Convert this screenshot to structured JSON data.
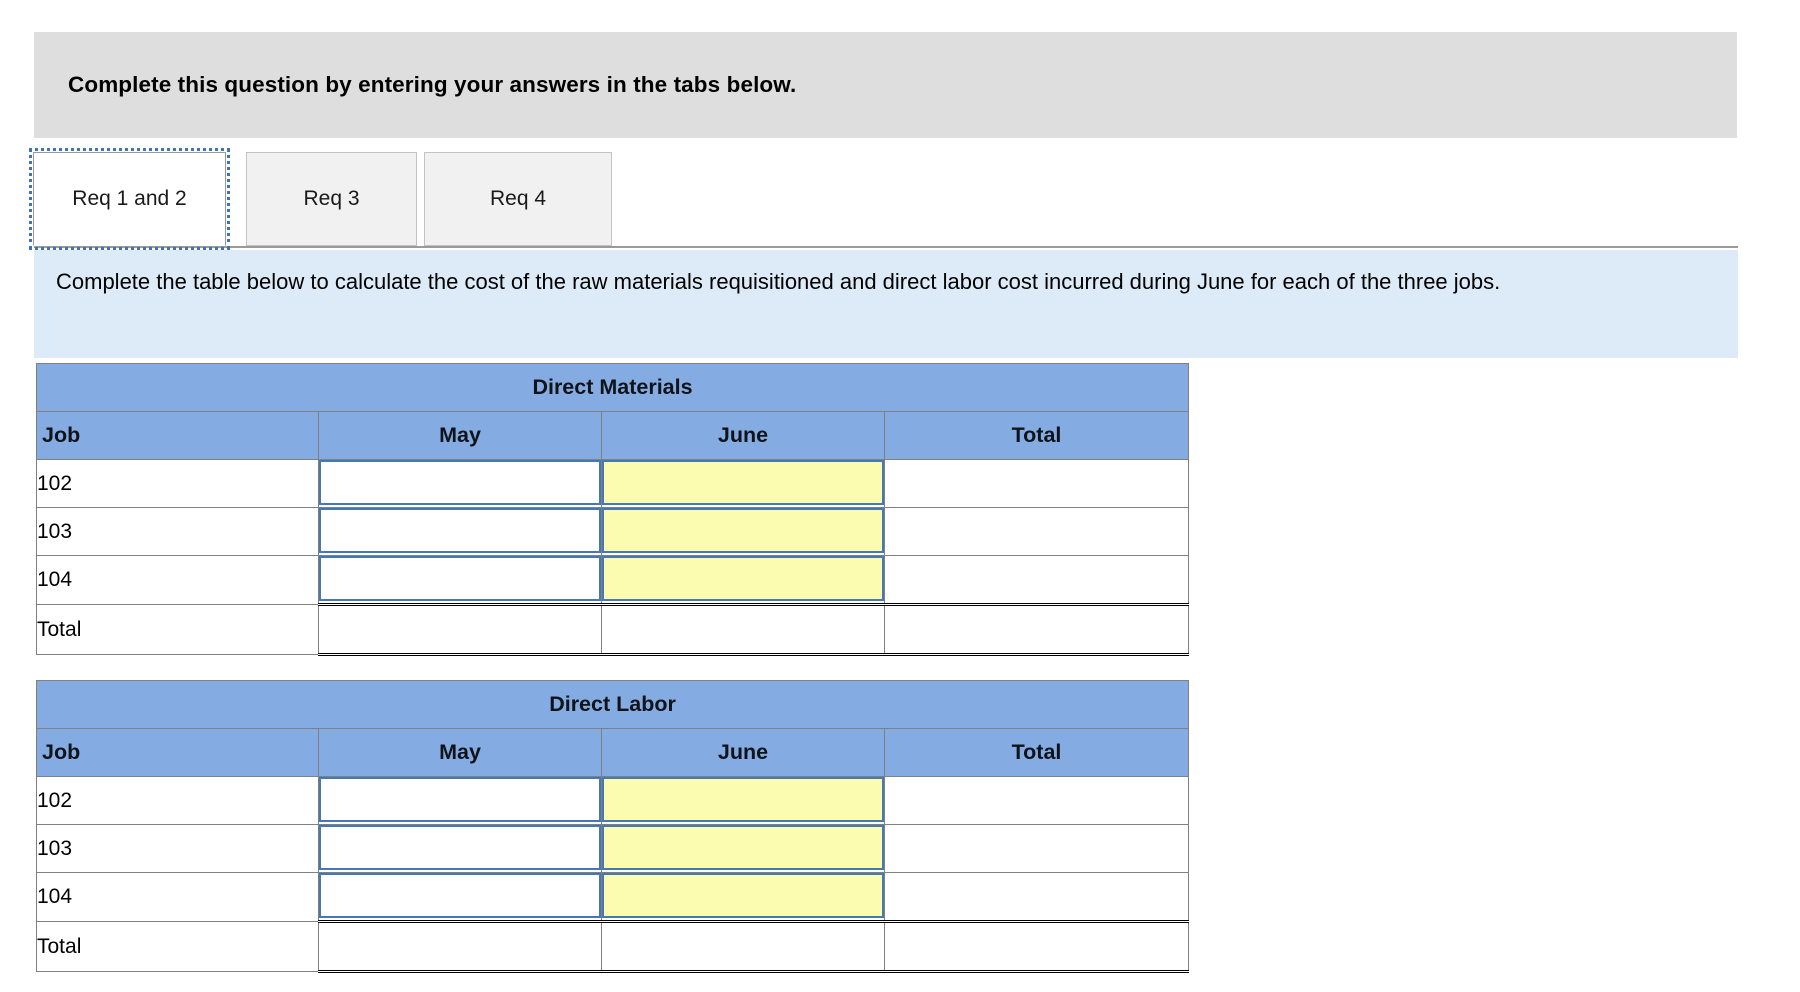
{
  "banner": {
    "title": "Complete this question by entering your answers in the tabs below."
  },
  "tabs": {
    "items": [
      {
        "label": "Req 1 and 2",
        "selected": true
      },
      {
        "label": "Req 3",
        "selected": false
      },
      {
        "label": "Req 4",
        "selected": false
      }
    ]
  },
  "instruction": {
    "text": "Complete the table below to calculate the cost of the raw materials requisitioned and direct labor cost incurred during June for each of the three jobs."
  },
  "colors": {
    "header_blue": "#84ace2",
    "input_yellow": "#fcfcb0",
    "input_border_blue": "#4678b4",
    "instruction_panel": "#dcebf7",
    "banner_gray": "#dedede",
    "grid_line": "#808080"
  },
  "tables": [
    {
      "title": "Direct Materials",
      "columns": [
        "Job",
        "May",
        "June",
        "Total"
      ],
      "rows": [
        {
          "job": "102",
          "may": "",
          "june": "",
          "total": ""
        },
        {
          "job": "103",
          "may": "",
          "june": "",
          "total": ""
        },
        {
          "job": "104",
          "may": "",
          "june": "",
          "total": ""
        }
      ],
      "total_row": {
        "job": "Total",
        "may": "",
        "june": "",
        "total": ""
      }
    },
    {
      "title": "Direct Labor",
      "columns": [
        "Job",
        "May",
        "June",
        "Total"
      ],
      "rows": [
        {
          "job": "102",
          "may": "",
          "june": "",
          "total": ""
        },
        {
          "job": "103",
          "may": "",
          "june": "",
          "total": ""
        },
        {
          "job": "104",
          "may": "",
          "june": "",
          "total": ""
        }
      ],
      "total_row": {
        "job": "Total",
        "may": "",
        "june": "",
        "total": ""
      }
    }
  ]
}
